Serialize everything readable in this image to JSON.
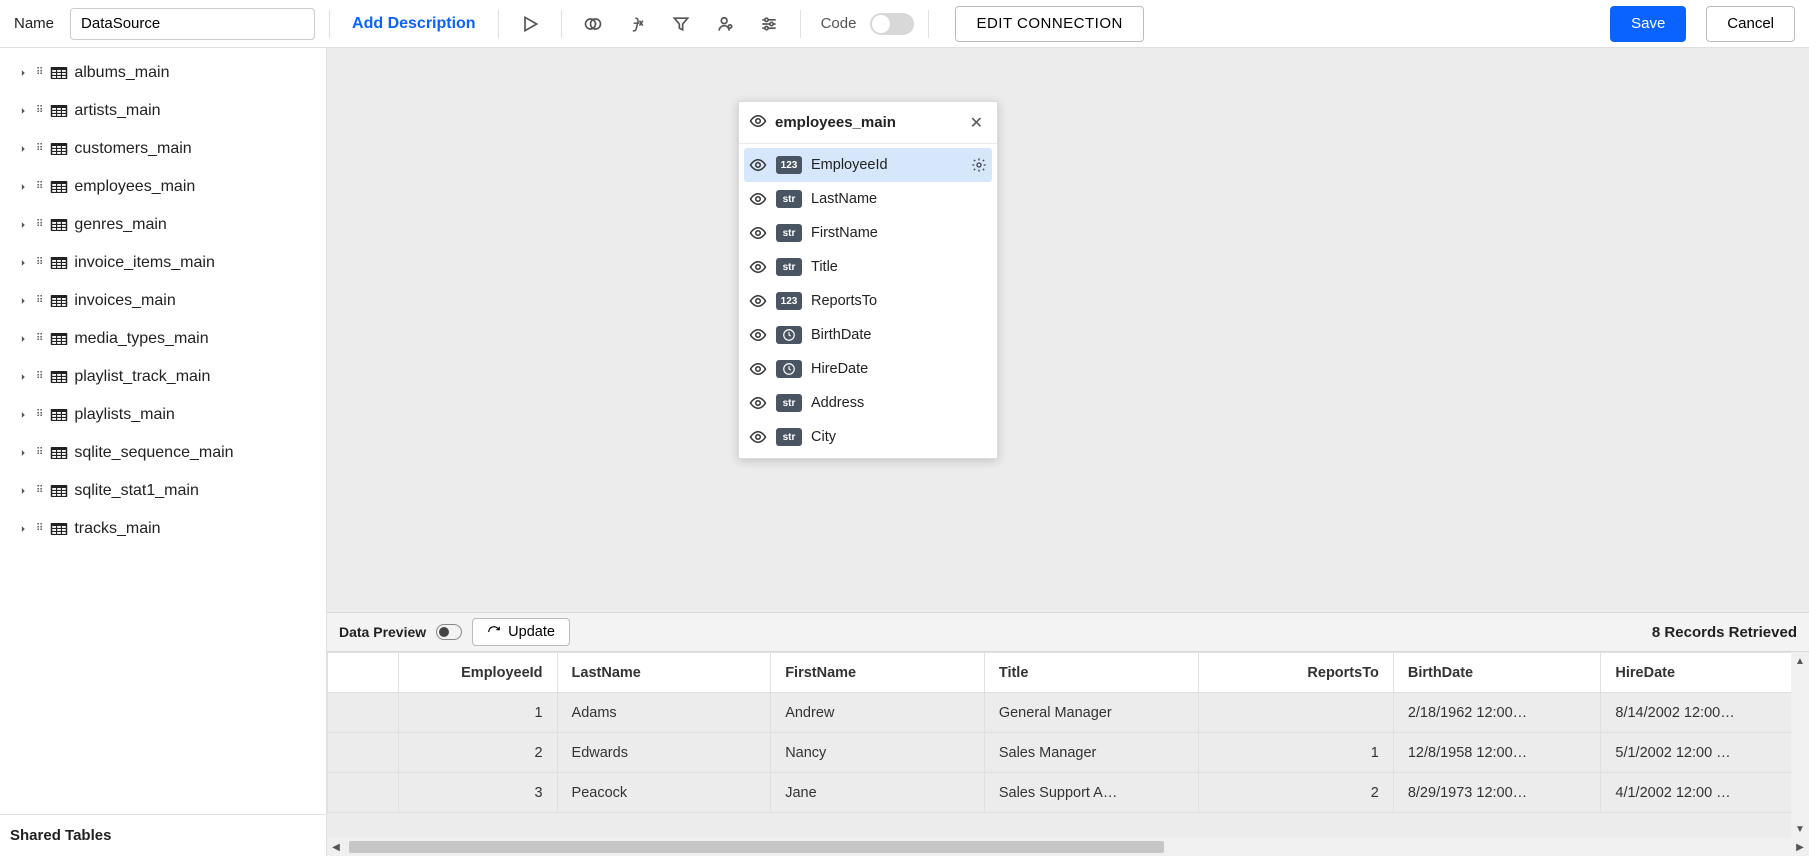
{
  "toolbar": {
    "name_label": "Name",
    "name_value": "DataSource",
    "add_description": "Add Description",
    "code_label": "Code",
    "edit_connection": "EDIT CONNECTION",
    "save_label": "Save",
    "cancel_label": "Cancel"
  },
  "sidebar": {
    "items": [
      "albums_main",
      "artists_main",
      "customers_main",
      "employees_main",
      "genres_main",
      "invoice_items_main",
      "invoices_main",
      "media_types_main",
      "playlist_track_main",
      "playlists_main",
      "sqlite_sequence_main",
      "sqlite_stat1_main",
      "tracks_main"
    ],
    "shared_tables": "Shared Tables"
  },
  "card": {
    "title": "employees_main",
    "fields": [
      {
        "type": "123",
        "name": "EmployeeId",
        "selected": true
      },
      {
        "type": "str",
        "name": "LastName"
      },
      {
        "type": "str",
        "name": "FirstName"
      },
      {
        "type": "str",
        "name": "Title"
      },
      {
        "type": "123",
        "name": "ReportsTo"
      },
      {
        "type": "date",
        "name": "BirthDate"
      },
      {
        "type": "date",
        "name": "HireDate"
      },
      {
        "type": "str",
        "name": "Address"
      },
      {
        "type": "str",
        "name": "City"
      }
    ]
  },
  "preview": {
    "label": "Data Preview",
    "update_label": "Update",
    "records_retrieved": "8 Records Retrieved",
    "columns": [
      "EmployeeId",
      "LastName",
      "FirstName",
      "Title",
      "ReportsTo",
      "BirthDate",
      "HireDate"
    ],
    "rows": [
      {
        "EmployeeId": "1",
        "LastName": "Adams",
        "FirstName": "Andrew",
        "Title": "General Manager",
        "ReportsTo": "",
        "BirthDate": "2/18/1962 12:00…",
        "HireDate": "8/14/2002 12:00…"
      },
      {
        "EmployeeId": "2",
        "LastName": "Edwards",
        "FirstName": "Nancy",
        "Title": "Sales Manager",
        "ReportsTo": "1",
        "BirthDate": "12/8/1958 12:00…",
        "HireDate": "5/1/2002 12:00 …"
      },
      {
        "EmployeeId": "3",
        "LastName": "Peacock",
        "FirstName": "Jane",
        "Title": "Sales Support A…",
        "ReportsTo": "2",
        "BirthDate": "8/29/1973 12:00…",
        "HireDate": "4/1/2002 12:00 …"
      }
    ]
  }
}
